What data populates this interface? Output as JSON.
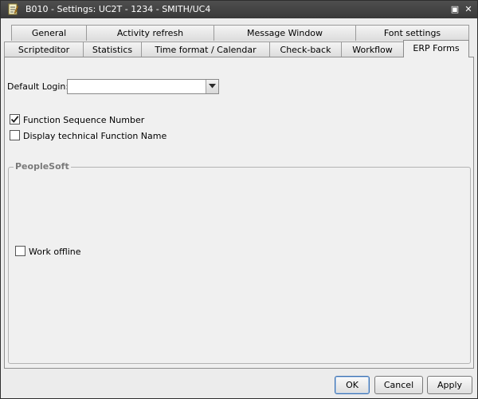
{
  "window": {
    "title": "B010 - Settings: UC2T - 1234 - SMITH/UC4",
    "icon": "settings-document-icon",
    "restore_glyph": "▣",
    "close_glyph": "✕"
  },
  "tabs_row1": [
    "General",
    "Activity refresh",
    "Message Window",
    "Font settings"
  ],
  "tabs_row2": [
    "Scripteditor",
    "Statistics",
    "Time format / Calendar",
    "Check-back",
    "Workflow",
    "ERP Forms"
  ],
  "active_tab": "ERP Forms",
  "form": {
    "default_login_label": "Default Login:",
    "default_login_value": "",
    "function_sequence_label": "Function Sequence Number",
    "function_sequence_checked": true,
    "display_technical_label": "Display technical Function Name",
    "display_technical_checked": false
  },
  "peoplesoft": {
    "title": "PeopleSoft",
    "work_offline_label": "Work offline",
    "work_offline_checked": false
  },
  "buttons": {
    "ok": "OK",
    "cancel": "Cancel",
    "apply": "Apply"
  },
  "colors": {
    "titlebar": "#3f3f3f",
    "window_bg": "#ececec",
    "group_title": "#7a7a7a"
  }
}
